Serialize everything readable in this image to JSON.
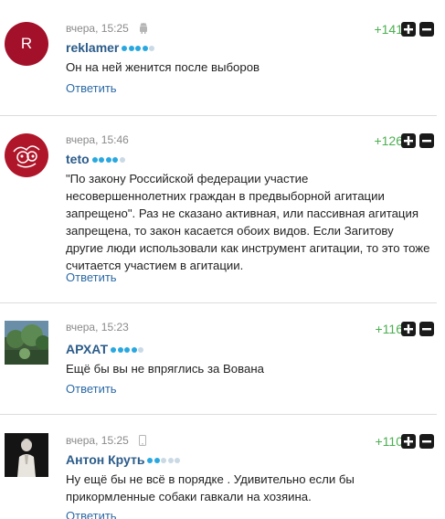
{
  "comments": [
    {
      "time": "вчера, 15:25",
      "device_icon": "android-icon",
      "author": "reklamer",
      "avatar_letter": "R",
      "rating": "+141",
      "level": 4,
      "text": "Он на ней женится после выборов",
      "reply_label": "Ответить"
    },
    {
      "time": "вчера, 15:46",
      "device_icon": "",
      "author": "teto",
      "rating": "+126",
      "level": 4,
      "text": "\"По закону Российской федерации участие несовершеннолетних граждан в предвыборной агитации запрещено\". Раз не сказано активная, или пассивная агитация запрещена, то закон касается обоих видов. Если Загитову другие люди использовали как инструмент агитации, то это тоже считается участием в агитации.",
      "reply_label": "Ответить"
    },
    {
      "time": "вчера, 15:23",
      "device_icon": "",
      "author": "АРХАТ",
      "rating": "+116",
      "level": 4,
      "text": "Ещё бы вы не впряглись за Вована",
      "reply_label": "Ответить"
    },
    {
      "time": "вчера, 15:25",
      "device_icon": "phone-icon",
      "author": "Антон Круть",
      "rating": "+110",
      "level": 2,
      "text": "Ну ещё бы не всё в порядке . Удивительно если бы прикормленные собаки гавкали на хозяина.",
      "reply_label": "Ответить"
    }
  ],
  "colors": {
    "author": "#2b5c8a",
    "reply": "#2b6aa5",
    "rating": "#4caf50",
    "dot_on": "#29a8e0",
    "dot_off": "#c9d9e5",
    "vote_button": "#1a1a1a",
    "avatar_reklamer": "#a3102a",
    "avatar_teto": "#b0162a"
  }
}
